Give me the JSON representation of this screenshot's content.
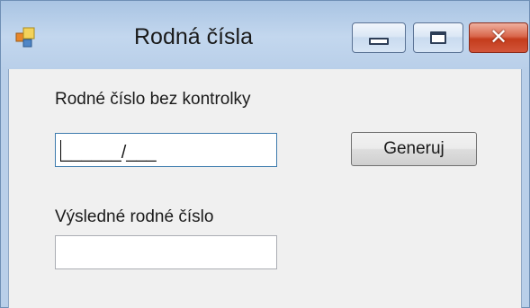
{
  "window": {
    "title": "Rodná čísla",
    "close_glyph": "✕",
    "icons": {
      "app": "app-form-icon",
      "minimize": "minimize-icon",
      "maximize": "maximize-icon",
      "close": "close-icon"
    }
  },
  "form": {
    "birth_number_label": "Rodné číslo bez kontrolky",
    "birth_number_value": "______/___",
    "generate_button_label": "Generuj",
    "result_label": "Výsledné rodné číslo",
    "result_value": ""
  },
  "colors": {
    "title_bar": "#b9cfe9",
    "client_background": "#f0f0f0",
    "close_button": "#c43c1c",
    "focused_border": "#3d7bad"
  }
}
